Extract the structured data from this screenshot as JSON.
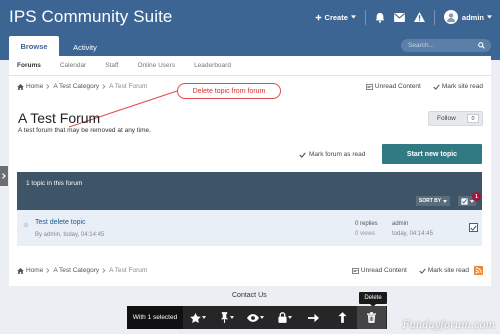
{
  "header": {
    "brand": "IPS Community Suite",
    "create_label": "Create",
    "username": "admin",
    "tabs": [
      "Browse",
      "Activity"
    ],
    "search_placeholder": "Search..."
  },
  "subnav": [
    "Forums",
    "Calendar",
    "Staff",
    "Online Users",
    "Leaderboard"
  ],
  "breadcrumb": {
    "home": "Home",
    "category": "A Test Category",
    "current": "A Test Forum"
  },
  "links": {
    "unread": "Unread Content",
    "mark_site_read": "Mark site read"
  },
  "annotation": "Delete topic from forum",
  "forum": {
    "title": "A Test Forum",
    "description": "A test forum that may be removed at any time.",
    "follow_label": "Follow",
    "follow_count": "0",
    "mark_forum_read": "Mark forum as read",
    "start_topic": "Start new topic"
  },
  "topic_list": {
    "count_label": "1 topic in this forum",
    "sort_label": "SORT BY",
    "selected_badge": "1"
  },
  "topic": {
    "title": "Test delete topic",
    "meta": "By admin, today, 04:14:45",
    "replies": "0 replies",
    "views": "0 views",
    "last_user": "admin",
    "last_time": "today, 04:14:45"
  },
  "footer": {
    "contact": "Contact Us"
  },
  "modbar": {
    "selected_label": "With 1 selected",
    "tooltip": "Delete"
  },
  "watermark": "Fundayforum.com",
  "colors": {
    "header": "#3d6594",
    "topic_bar": "#3d5566",
    "start_button": "#317983",
    "annotation": "#d63333"
  }
}
